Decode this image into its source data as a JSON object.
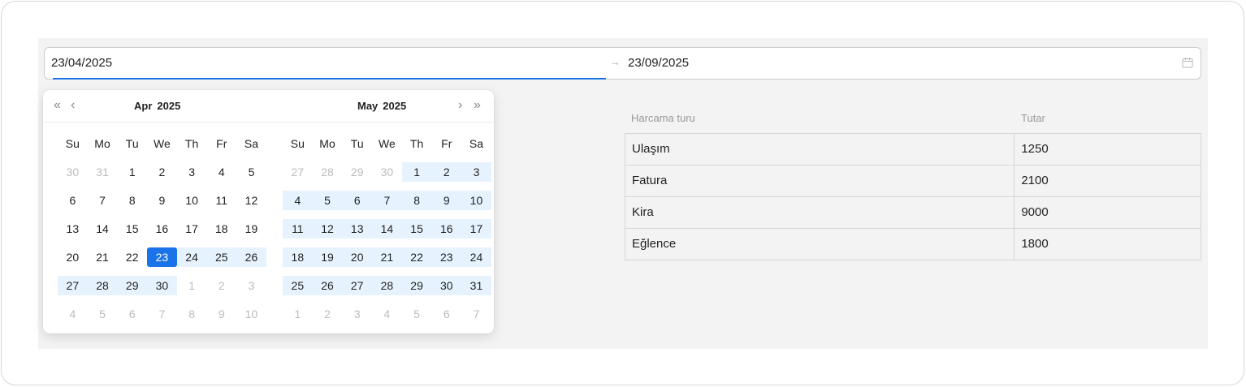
{
  "range": {
    "start": "23/04/2025",
    "separator": "→",
    "end": "23/09/2025"
  },
  "table": {
    "headers": [
      "Harcama turu",
      "Tutar"
    ],
    "rows": [
      [
        "Ulaşım",
        "1250"
      ],
      [
        "Fatura",
        "2100"
      ],
      [
        "Kira",
        "9000"
      ],
      [
        "Eğlence",
        "1800"
      ]
    ]
  },
  "calendar": {
    "nav": {
      "prev_year": "«",
      "prev_month": "‹",
      "next_month": "›",
      "next_year": "»"
    },
    "weekdays": [
      "Su",
      "Mo",
      "Tu",
      "We",
      "Th",
      "Fr",
      "Sa"
    ],
    "months": [
      {
        "month": "Apr",
        "year": "2025",
        "weeks": [
          [
            {
              "d": "30",
              "m": 1
            },
            {
              "d": "31",
              "m": 1
            },
            {
              "d": "1"
            },
            {
              "d": "2"
            },
            {
              "d": "3"
            },
            {
              "d": "4"
            },
            {
              "d": "5"
            }
          ],
          [
            {
              "d": "6"
            },
            {
              "d": "7"
            },
            {
              "d": "8"
            },
            {
              "d": "9"
            },
            {
              "d": "10"
            },
            {
              "d": "11"
            },
            {
              "d": "12"
            }
          ],
          [
            {
              "d": "13"
            },
            {
              "d": "14"
            },
            {
              "d": "15"
            },
            {
              "d": "16"
            },
            {
              "d": "17"
            },
            {
              "d": "18"
            },
            {
              "d": "19"
            }
          ],
          [
            {
              "d": "20"
            },
            {
              "d": "21"
            },
            {
              "d": "22"
            },
            {
              "d": "23",
              "s": 1
            },
            {
              "d": "24",
              "r": 1
            },
            {
              "d": "25",
              "r": 1
            },
            {
              "d": "26",
              "r": 1
            }
          ],
          [
            {
              "d": "27",
              "r": 1
            },
            {
              "d": "28",
              "r": 1
            },
            {
              "d": "29",
              "r": 1
            },
            {
              "d": "30",
              "r": 1
            },
            {
              "d": "1",
              "m": 1
            },
            {
              "d": "2",
              "m": 1
            },
            {
              "d": "3",
              "m": 1
            }
          ],
          [
            {
              "d": "4",
              "m": 1
            },
            {
              "d": "5",
              "m": 1
            },
            {
              "d": "6",
              "m": 1
            },
            {
              "d": "7",
              "m": 1
            },
            {
              "d": "8",
              "m": 1
            },
            {
              "d": "9",
              "m": 1
            },
            {
              "d": "10",
              "m": 1
            }
          ]
        ]
      },
      {
        "month": "May",
        "year": "2025",
        "weeks": [
          [
            {
              "d": "27",
              "m": 1
            },
            {
              "d": "28",
              "m": 1
            },
            {
              "d": "29",
              "m": 1
            },
            {
              "d": "30",
              "m": 1
            },
            {
              "d": "1",
              "r": 1
            },
            {
              "d": "2",
              "r": 1
            },
            {
              "d": "3",
              "r": 1
            }
          ],
          [
            {
              "d": "4",
              "r": 1
            },
            {
              "d": "5",
              "r": 1
            },
            {
              "d": "6",
              "r": 1
            },
            {
              "d": "7",
              "r": 1
            },
            {
              "d": "8",
              "r": 1
            },
            {
              "d": "9",
              "r": 1
            },
            {
              "d": "10",
              "r": 1
            }
          ],
          [
            {
              "d": "11",
              "r": 1
            },
            {
              "d": "12",
              "r": 1
            },
            {
              "d": "13",
              "r": 1
            },
            {
              "d": "14",
              "r": 1
            },
            {
              "d": "15",
              "r": 1
            },
            {
              "d": "16",
              "r": 1
            },
            {
              "d": "17",
              "r": 1
            }
          ],
          [
            {
              "d": "18",
              "r": 1
            },
            {
              "d": "19",
              "r": 1
            },
            {
              "d": "20",
              "r": 1
            },
            {
              "d": "21",
              "r": 1
            },
            {
              "d": "22",
              "r": 1
            },
            {
              "d": "23",
              "r": 1
            },
            {
              "d": "24",
              "r": 1
            }
          ],
          [
            {
              "d": "25",
              "r": 1
            },
            {
              "d": "26",
              "r": 1
            },
            {
              "d": "27",
              "r": 1
            },
            {
              "d": "28",
              "r": 1
            },
            {
              "d": "29",
              "r": 1
            },
            {
              "d": "30",
              "r": 1
            },
            {
              "d": "31",
              "r": 1
            }
          ],
          [
            {
              "d": "1",
              "m": 1
            },
            {
              "d": "2",
              "m": 1
            },
            {
              "d": "3",
              "m": 1
            },
            {
              "d": "4",
              "m": 1
            },
            {
              "d": "5",
              "m": 1
            },
            {
              "d": "6",
              "m": 1
            },
            {
              "d": "7",
              "m": 1
            }
          ]
        ]
      }
    ]
  },
  "colors": {
    "accent": "#1a73e8",
    "range_bg": "#e6f3ff"
  }
}
